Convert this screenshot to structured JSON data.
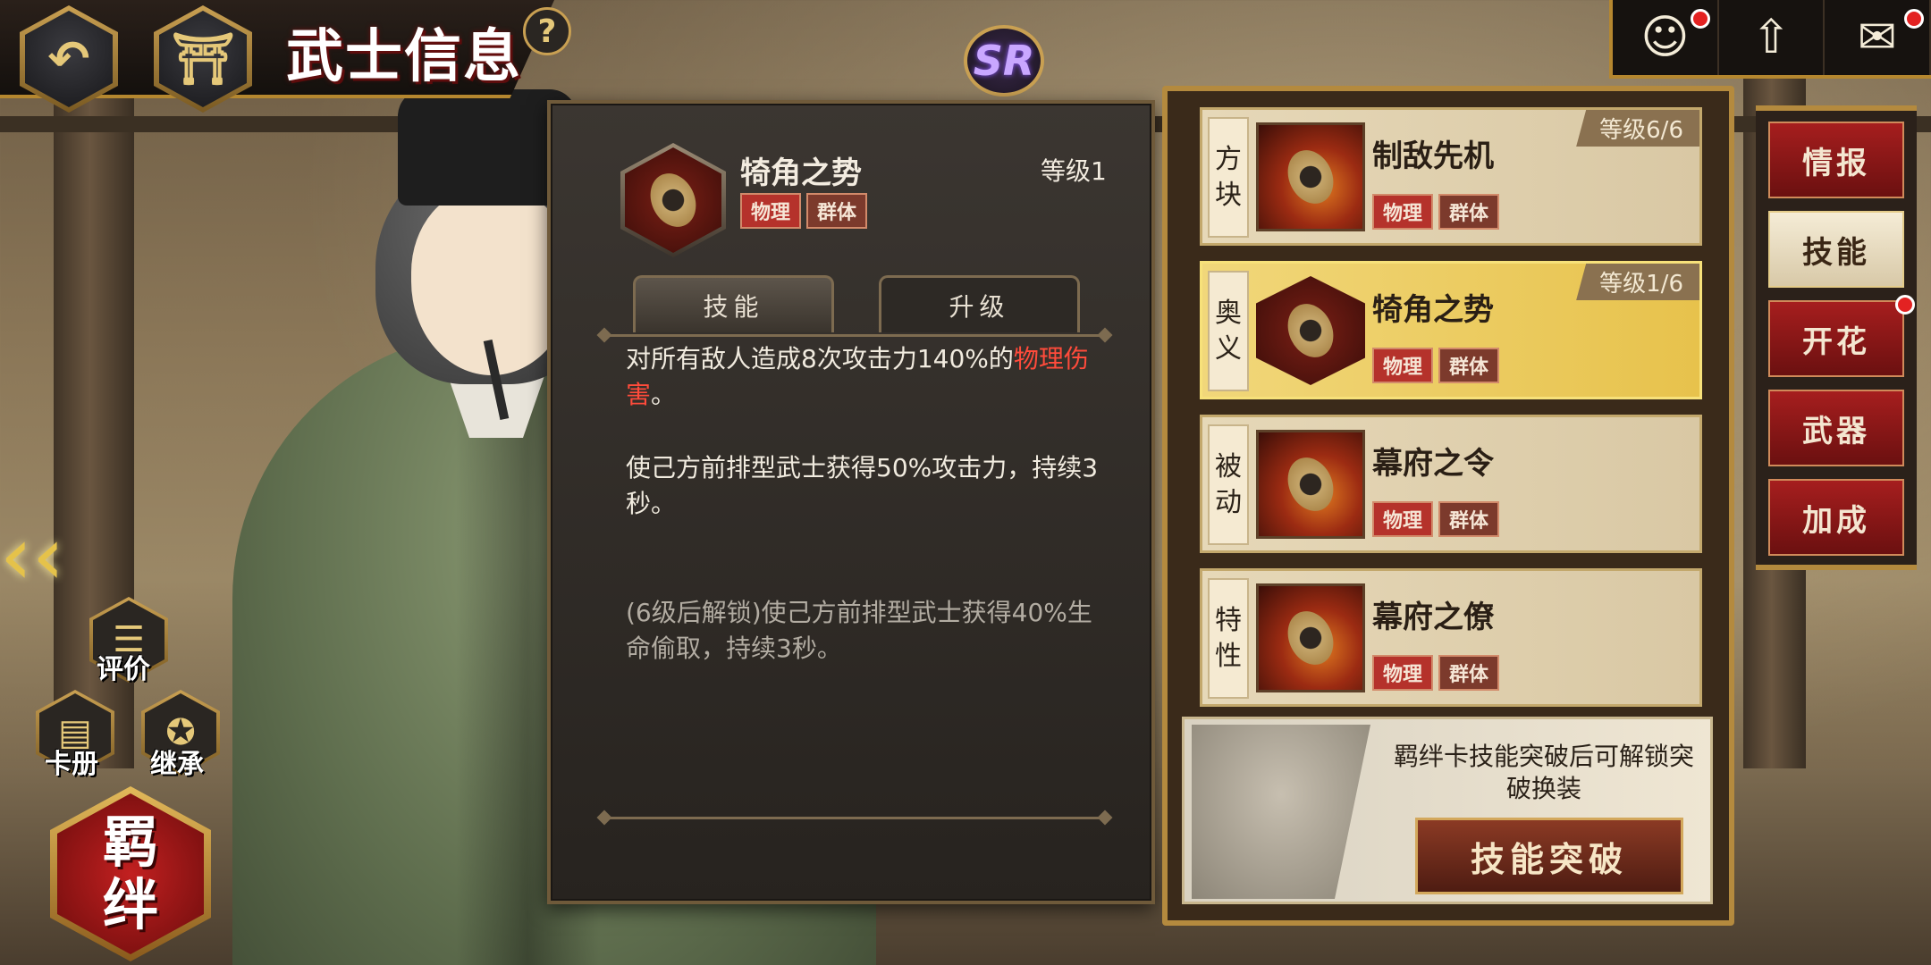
{
  "header": {
    "title": "武士信息",
    "help_label": "?",
    "rarity": "SR"
  },
  "notifications": {
    "icons": [
      "character-icon",
      "rank-up-icon",
      "mail-icon"
    ]
  },
  "detail": {
    "skill_name": "犄角之势",
    "level_label": "等级1",
    "tags": [
      "物理",
      "群体"
    ],
    "tabs": [
      "技能",
      "升级"
    ],
    "desc1_pre": "对所有敌人造成8次攻击力140%的",
    "desc1_highlight": "物理伤害",
    "desc1_post": "。",
    "desc2": "使己方前排型武士获得50%攻击力，持续3秒。",
    "desc3": "(6级后解锁)使己方前排型武士获得40%生命偷取，持续3秒。"
  },
  "skills": [
    {
      "type": "方块",
      "name": "制敌先机",
      "level": "等级6/6",
      "tags": [
        "物理",
        "群体"
      ],
      "active": false
    },
    {
      "type": "奥义",
      "name": "犄角之势",
      "level": "等级1/6",
      "tags": [
        "物理",
        "群体"
      ],
      "active": true
    },
    {
      "type": "被动",
      "name": "幕府之令",
      "level": "",
      "tags": [
        "物理",
        "群体"
      ],
      "active": false
    },
    {
      "type": "特性",
      "name": "幕府之僚",
      "level": "",
      "tags": [
        "物理",
        "群体"
      ],
      "active": false
    }
  ],
  "breakthrough": {
    "text": "羁绊卡技能突破后可解锁突破换装",
    "button": "技能突破"
  },
  "side_tabs": [
    "情报",
    "技能",
    "开花",
    "武器",
    "加成"
  ],
  "left_buttons": {
    "review": "评价",
    "album": "卡册",
    "inherit": "继承",
    "bond": "羁绊"
  },
  "colors": {
    "accent_gold": "#b48a3e",
    "tag_red": "#b5322b",
    "highlight_red": "#ff4b3b",
    "active_row": "#e7c24c"
  }
}
